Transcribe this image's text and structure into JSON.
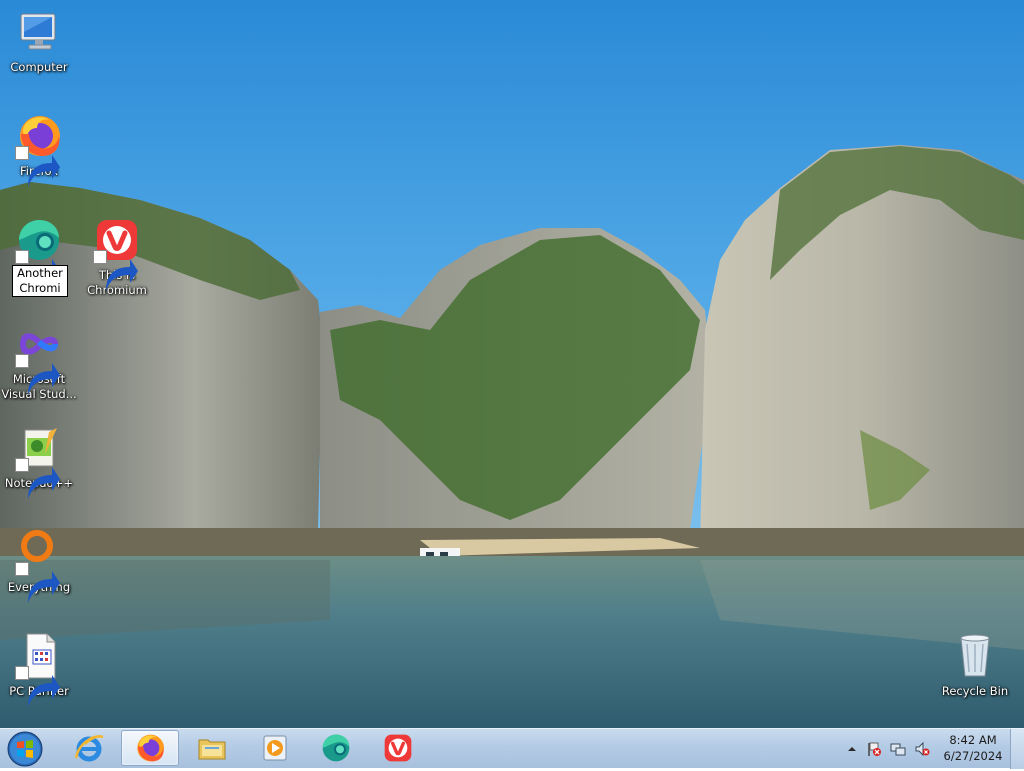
{
  "desktop": {
    "icons": [
      {
        "name": "computer",
        "label": "Computer"
      },
      {
        "name": "firefox",
        "label": "Firefox"
      },
      {
        "name": "another-chromium",
        "label": "Another Chromi"
      },
      {
        "name": "vivaldi",
        "label": "This is Chromium"
      },
      {
        "name": "visual-studio",
        "label": "Microsoft Visual Stud..."
      },
      {
        "name": "notepad-plus-plus",
        "label": "Notepad++"
      },
      {
        "name": "everything",
        "label": "Everything"
      },
      {
        "name": "pc-purifier",
        "label": "PC Purifier"
      },
      {
        "name": "recycle-bin",
        "label": "Recycle Bin"
      }
    ],
    "rename_field_value": "Another\nChromi"
  },
  "taskbar": {
    "pinned": [
      "internet-explorer-icon",
      "firefox-icon",
      "file-explorer-icon",
      "media-player-icon",
      "chromium-icon",
      "vivaldi-icon"
    ],
    "active": "firefox-icon",
    "tray_icons": [
      "show-hidden-icons-chevron",
      "action-center-flag-icon",
      "network-icon",
      "volume-muted-icon"
    ],
    "clock": {
      "time": "8:42 AM",
      "date": "6/27/2024"
    }
  },
  "colors": {
    "sky_top": "#2f8ed8",
    "water": "#4b7b8c",
    "taskbar": "#b4cbe5"
  }
}
